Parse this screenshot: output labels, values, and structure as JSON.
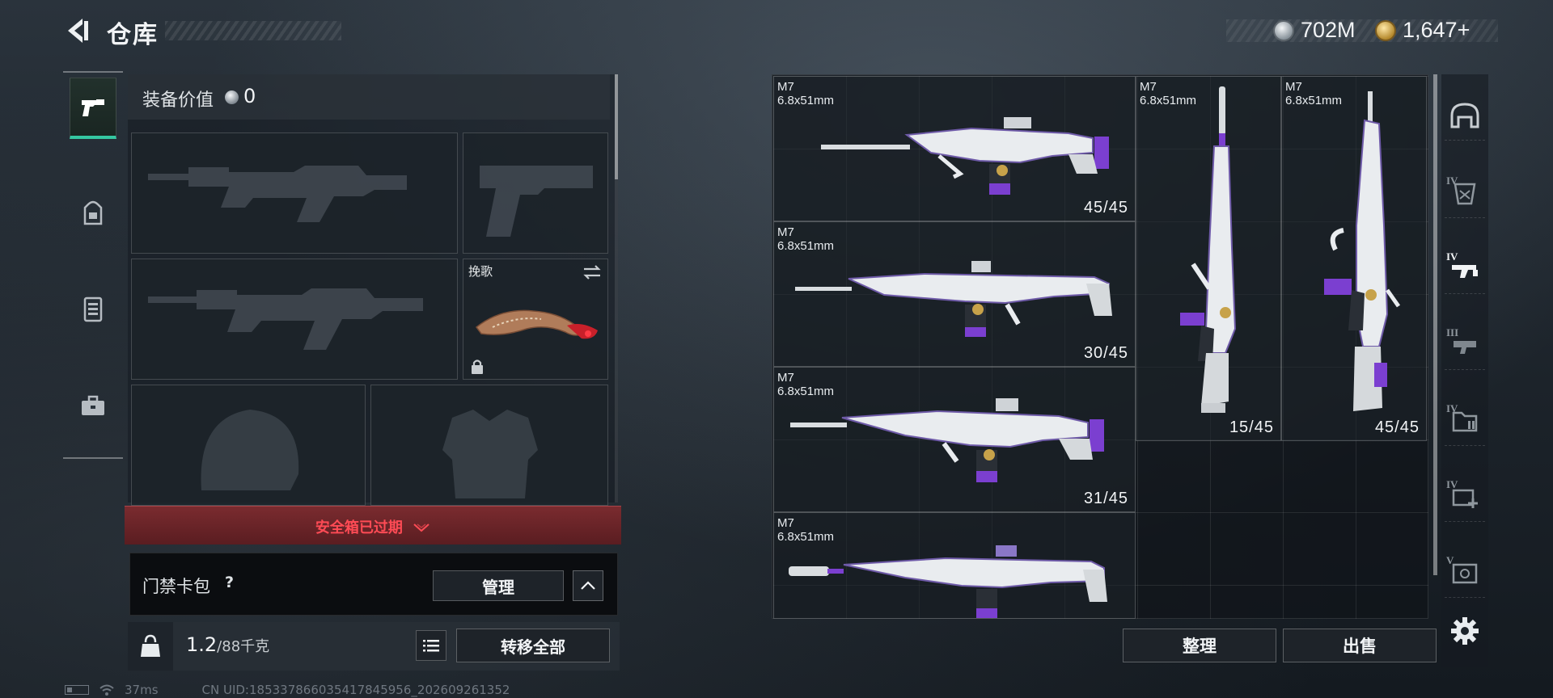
{
  "header": {
    "title": "仓库",
    "currency": [
      {
        "icon": "silver-coin-icon",
        "value": "702M"
      },
      {
        "icon": "gold-coin-icon",
        "value": "1,647+"
      }
    ]
  },
  "left_rail": {
    "items": [
      {
        "icon": "pistol-icon",
        "active": true
      },
      {
        "icon": "backpack-icon",
        "active": false
      },
      {
        "icon": "vest-icon",
        "active": false
      },
      {
        "icon": "toolbox-icon",
        "active": false
      }
    ]
  },
  "equipment": {
    "value_label": "装备价值",
    "value": "0",
    "melee_label": "挽歌",
    "safebox_text": "安全箱已过期"
  },
  "card_pack": {
    "label": "门禁卡包",
    "help": "?",
    "manage_label": "管理"
  },
  "weight": {
    "current": "1.2",
    "max": "/88千克",
    "icon_label": "KG",
    "transfer_label": "转移全部"
  },
  "status": {
    "ping": "37ms",
    "uid": "CN UID:18533786603541784595​6_202609261352"
  },
  "stash": {
    "items": [
      {
        "name": "M7",
        "caliber": "6.8x51mm",
        "ammo": "45/45"
      },
      {
        "name": "M7",
        "caliber": "6.8x51mm",
        "ammo": "30/45"
      },
      {
        "name": "M7",
        "caliber": "6.8x51mm",
        "ammo": "31/45"
      },
      {
        "name": "M7",
        "caliber": "6.8x51mm",
        "ammo": ""
      },
      {
        "name": "M7",
        "caliber": "6.8x51mm",
        "ammo": "15/45"
      },
      {
        "name": "M7",
        "caliber": "6.8x51mm",
        "ammo": "45/45"
      }
    ],
    "sort_label": "整理",
    "sell_label": "出售"
  },
  "right_rail": {
    "filters": [
      {
        "icon": "helmet-filter-icon",
        "tier": ""
      },
      {
        "icon": "tier4-armor-filter-icon",
        "tier": "IV"
      },
      {
        "icon": "tier4-rifle-filter-icon",
        "tier": "IV"
      },
      {
        "icon": "tier3-weapon-filter-icon",
        "tier": "III"
      },
      {
        "icon": "tier4-folder-filter-icon",
        "tier": "IV"
      },
      {
        "icon": "tier4-medkit-filter-icon",
        "tier": "IV"
      },
      {
        "icon": "tier5-safe-filter-icon",
        "tier": "V"
      }
    ]
  }
}
